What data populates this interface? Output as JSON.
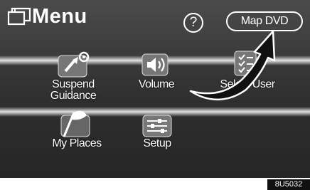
{
  "header": {
    "title": "Menu",
    "help_label": "?",
    "map_dvd_label": "Map DVD"
  },
  "tiles": [
    {
      "id": "suspend-guidance",
      "line1": "Suspend",
      "line2": "Guidance",
      "icon": "flag-pin-icon"
    },
    {
      "id": "volume",
      "line1": "Volume",
      "line2": "",
      "icon": "speaker-icon"
    },
    {
      "id": "select-user",
      "line1": "Select User",
      "line2": "",
      "icon": "checklist-icon"
    },
    {
      "id": "my-places",
      "line1": "My Places",
      "line2": "",
      "icon": "flag-icon"
    },
    {
      "id": "setup",
      "line1": "Setup",
      "line2": "",
      "icon": "sliders-icon"
    }
  ],
  "image_code": "8U5032",
  "colors": {
    "screen_bg": "#383838",
    "text": "#ffffff"
  }
}
